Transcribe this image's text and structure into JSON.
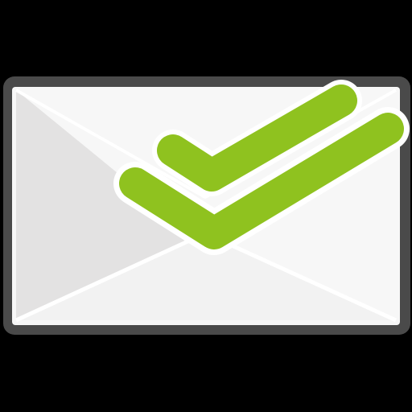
{
  "icon": {
    "name": "envelope-double-check-icon",
    "colors": {
      "background": "#000000",
      "frame": "#4a4a4a",
      "envelope_body": "#f7f7f7",
      "envelope_left_fold": "#e3e2e2",
      "envelope_bottom_fold": "#f2f2f2",
      "envelope_lines": "#ffffff",
      "check_green": "#8fc21f",
      "check_outline": "#ffffff"
    }
  }
}
